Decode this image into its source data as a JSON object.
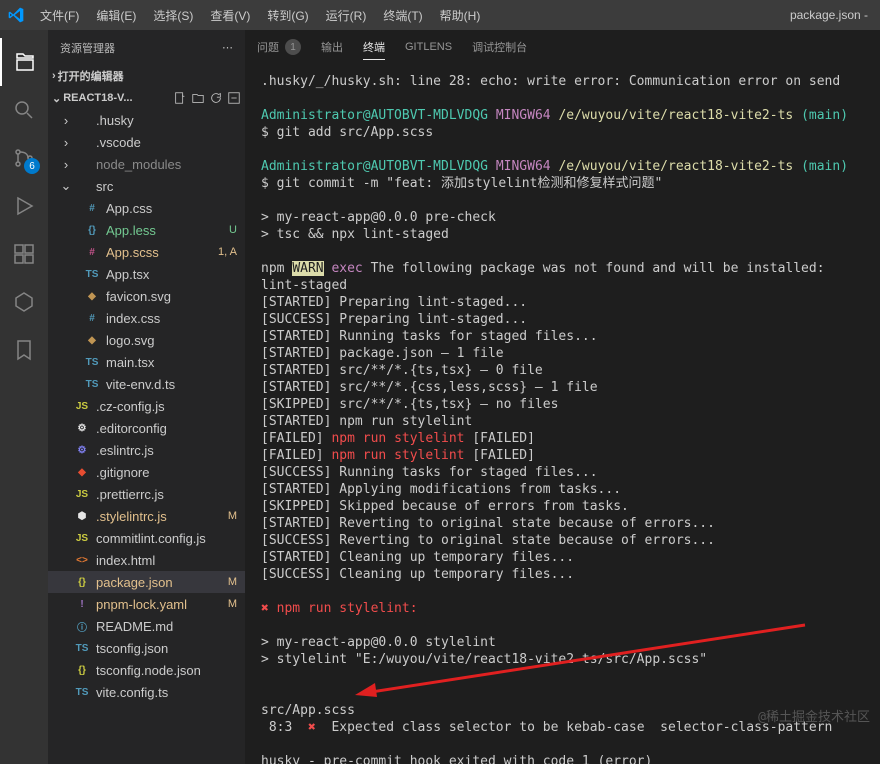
{
  "titlebar": {
    "filename": "package.json -",
    "menus": [
      "文件(F)",
      "编辑(E)",
      "选择(S)",
      "查看(V)",
      "转到(G)",
      "运行(R)",
      "终端(T)",
      "帮助(H)"
    ]
  },
  "activitybar": {
    "scm_badge": "6"
  },
  "sidebar": {
    "title": "资源管理器",
    "open_editors": "打开的编辑器",
    "project": "REACT18-V..."
  },
  "tree": [
    {
      "type": "folder",
      "name": ".husky",
      "depth": 1,
      "expanded": false
    },
    {
      "type": "folder",
      "name": ".vscode",
      "depth": 1,
      "expanded": false
    },
    {
      "type": "folder",
      "name": "node_modules",
      "depth": 1,
      "expanded": false,
      "dim": true
    },
    {
      "type": "folder",
      "name": "src",
      "depth": 1,
      "expanded": true
    },
    {
      "type": "file",
      "name": "App.css",
      "depth": 2,
      "icon": "#",
      "iconColor": "#519aba"
    },
    {
      "type": "file",
      "name": "App.less",
      "depth": 2,
      "icon": "{}",
      "iconColor": "#519aba",
      "decoration": "U",
      "gitClass": "git-u"
    },
    {
      "type": "file",
      "name": "App.scss",
      "depth": 2,
      "icon": "#",
      "iconColor": "#c6538c",
      "decoration": "1, A",
      "gitClass": "git-a"
    },
    {
      "type": "file",
      "name": "App.tsx",
      "depth": 2,
      "icon": "TS",
      "iconColor": "#519aba"
    },
    {
      "type": "file",
      "name": "favicon.svg",
      "depth": 2,
      "icon": "◆",
      "iconColor": "#c09553"
    },
    {
      "type": "file",
      "name": "index.css",
      "depth": 2,
      "icon": "#",
      "iconColor": "#519aba"
    },
    {
      "type": "file",
      "name": "logo.svg",
      "depth": 2,
      "icon": "◆",
      "iconColor": "#c09553"
    },
    {
      "type": "file",
      "name": "main.tsx",
      "depth": 2,
      "icon": "TS",
      "iconColor": "#519aba"
    },
    {
      "type": "file",
      "name": "vite-env.d.ts",
      "depth": 2,
      "icon": "TS",
      "iconColor": "#519aba"
    },
    {
      "type": "file",
      "name": ".cz-config.js",
      "depth": 1,
      "icon": "JS",
      "iconColor": "#cbcb41"
    },
    {
      "type": "file",
      "name": ".editorconfig",
      "depth": 1,
      "icon": "⚙",
      "iconColor": "#e6e6e6"
    },
    {
      "type": "file",
      "name": ".eslintrc.js",
      "depth": 1,
      "icon": "⚙",
      "iconColor": "#8080f2"
    },
    {
      "type": "file",
      "name": ".gitignore",
      "depth": 1,
      "icon": "◆",
      "iconColor": "#e84d31"
    },
    {
      "type": "file",
      "name": ".prettierrc.js",
      "depth": 1,
      "icon": "JS",
      "iconColor": "#cbcb41"
    },
    {
      "type": "file",
      "name": ".stylelintrc.js",
      "depth": 1,
      "icon": "⬢",
      "iconColor": "#e6e6e6",
      "decoration": "M",
      "gitClass": "git-m"
    },
    {
      "type": "file",
      "name": "commitlint.config.js",
      "depth": 1,
      "icon": "JS",
      "iconColor": "#cbcb41"
    },
    {
      "type": "file",
      "name": "index.html",
      "depth": 1,
      "icon": "<>",
      "iconColor": "#e37933"
    },
    {
      "type": "file",
      "name": "package.json",
      "depth": 1,
      "icon": "{}",
      "iconColor": "#cbcb41",
      "decoration": "M",
      "gitClass": "git-m",
      "selected": true
    },
    {
      "type": "file",
      "name": "pnpm-lock.yaml",
      "depth": 1,
      "icon": "!",
      "iconColor": "#a074c4",
      "decoration": "M",
      "gitClass": "git-m"
    },
    {
      "type": "file",
      "name": "README.md",
      "depth": 1,
      "icon": "ⓘ",
      "iconColor": "#519aba"
    },
    {
      "type": "file",
      "name": "tsconfig.json",
      "depth": 1,
      "icon": "TS",
      "iconColor": "#519aba"
    },
    {
      "type": "file",
      "name": "tsconfig.node.json",
      "depth": 1,
      "icon": "{}",
      "iconColor": "#cbcb41"
    },
    {
      "type": "file",
      "name": "vite.config.ts",
      "depth": 1,
      "icon": "TS",
      "iconColor": "#519aba"
    }
  ],
  "panel": {
    "tabs": {
      "problems": "问题",
      "problems_count": "1",
      "output": "输出",
      "terminal": "终端",
      "gitlens": "GITLENS",
      "debug_console": "调试控制台"
    }
  },
  "terminal": {
    "l1": ".husky/_/husky.sh: line 28: echo: write error: Communication error on send",
    "prompt_user": "Administrator@AUTOBVT-MDLVDQG",
    "prompt_env": "MINGW64",
    "prompt_path": "/e/wuyou/vite/react18-vite2-ts",
    "prompt_branch": "(main)",
    "cmd1": "$ git add src/App.scss",
    "cmd2": "$ git commit -m \"feat: 添加stylelint检测和修复样式问题\"",
    "l_precheck": "> my-react-app@0.0.0 pre-check",
    "l_tsc": "> tsc && npx lint-staged",
    "npm_label": "npm",
    "warn_label": "WARN",
    "exec_label": "exec",
    "warn_msg": " The following package was not found and will be installed: lint-staged",
    "s1": "[STARTED] Preparing lint-staged...",
    "s2": "[SUCCESS] Preparing lint-staged...",
    "s3": "[STARTED] Running tasks for staged files...",
    "s4": "[STARTED] package.json — 1 file",
    "s5": "[STARTED] src/**/*.{ts,tsx} — 0 file",
    "s6": "[STARTED] src/**/*.{css,less,scss} — 1 file",
    "s7": "[SKIPPED] src/**/*.{ts,tsx} — no files",
    "s8": "[STARTED] npm run stylelint",
    "fail_prefix": "[FAILED] ",
    "fail_cmd": "npm run stylelint",
    "fail_suffix": " [FAILED]",
    "s9": "[SUCCESS] Running tasks for staged files...",
    "s10": "[STARTED] Applying modifications from tasks...",
    "s11": "[SKIPPED] Skipped because of errors from tasks.",
    "s12": "[STARTED] Reverting to original state because of errors...",
    "s13": "[SUCCESS] Reverting to original state because of errors...",
    "s14": "[STARTED] Cleaning up temporary files...",
    "s15": "[SUCCESS] Cleaning up temporary files...",
    "err_x": "✖ ",
    "err_run": "npm run stylelint:",
    "l_style1": "> my-react-app@0.0.0 stylelint",
    "l_style2": "> stylelint \"E:/wuyou/vite/react18-vite2-ts/src/App.scss\"",
    "err_file": "src/App.scss",
    "err_loc": " 8:3  ",
    "err_x2": "✖",
    "err_msg": "  Expected class selector to be kebab-case  selector-class-pattern",
    "husky": "husky - pre-commit hook exited with code 1 (error)"
  },
  "watermark": "@稀土掘金技术社区"
}
